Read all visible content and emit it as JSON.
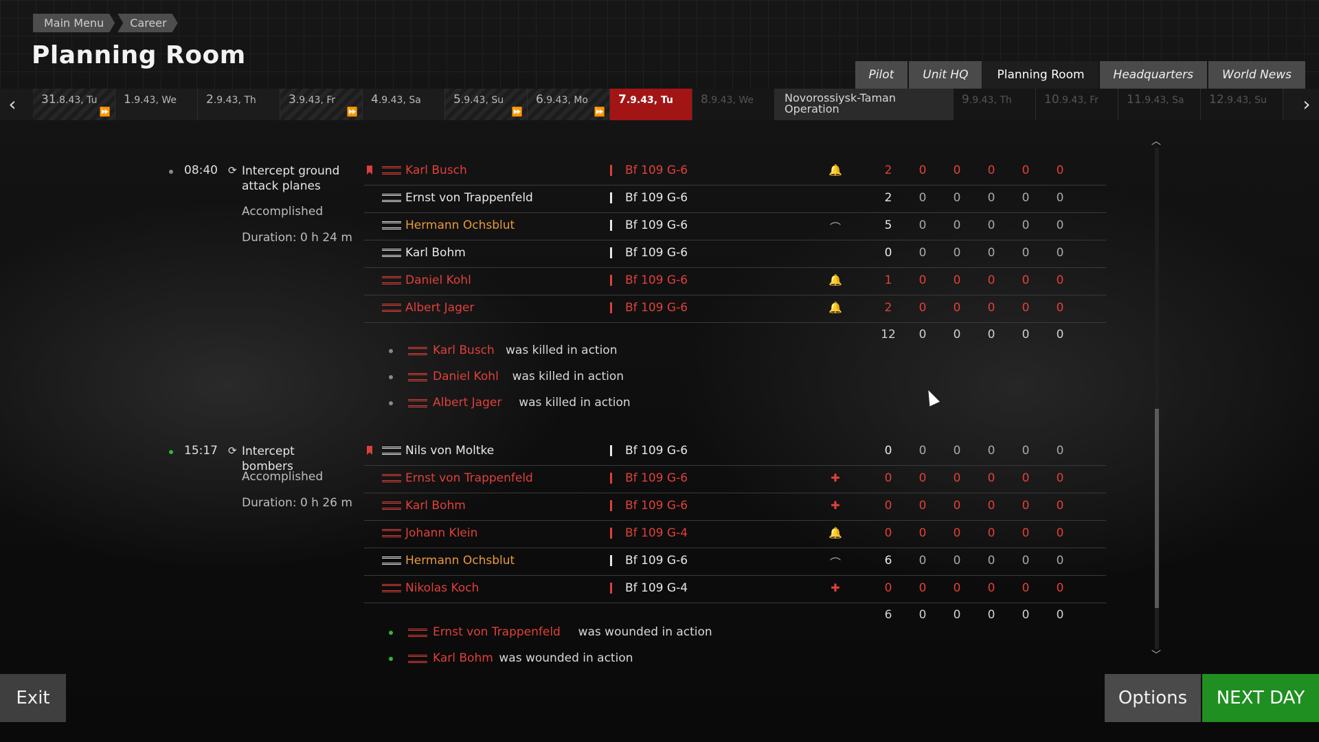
{
  "breadcrumb": [
    "Main Menu",
    "Career"
  ],
  "title": "Planning Room",
  "tabs": [
    {
      "label": "Pilot",
      "active": false
    },
    {
      "label": "Unit HQ",
      "active": false
    },
    {
      "label": "Planning Room",
      "active": true
    },
    {
      "label": "Headquarters",
      "active": false
    },
    {
      "label": "World News",
      "active": false
    }
  ],
  "timeline": {
    "days": [
      {
        "num": "31",
        "rest": ".8.43, Tu",
        "style": "striped"
      },
      {
        "num": "1",
        "rest": ".9.43, We",
        "style": "plain"
      },
      {
        "num": "2",
        "rest": ".9.43, Th",
        "style": "plain"
      },
      {
        "num": "3",
        "rest": ".9.43, Fr",
        "style": "striped"
      },
      {
        "num": "4",
        "rest": ".9.43, Sa",
        "style": "plain"
      },
      {
        "num": "5",
        "rest": ".9.43, Su",
        "style": "striped"
      },
      {
        "num": "6",
        "rest": ".9.43, Mo",
        "style": "striped"
      },
      {
        "num": "7",
        "rest": ".9.43, Tu",
        "style": "today"
      },
      {
        "num": "8",
        "rest": ".9.43, We",
        "style": "future"
      }
    ],
    "operation": "Novorossiysk-Taman Operation",
    "future_days": [
      {
        "num": "9",
        "rest": ".9.43, Th"
      },
      {
        "num": "10",
        "rest": ".9.43, Fr"
      },
      {
        "num": "11",
        "rest": ".9.43, Sa"
      },
      {
        "num": "12",
        "rest": ".9.43, Su"
      }
    ]
  },
  "missions": [
    {
      "time": "08:40",
      "task": "Intercept ground attack planes",
      "status": "Accomplished",
      "duration": "Duration: 0 h 24 m",
      "pilots": [
        {
          "name": "Karl Busch",
          "plane": "Bf 109 G-6",
          "color": "red",
          "status_icon": "killed-icon",
          "stats": [
            2,
            0,
            0,
            0,
            0,
            0
          ],
          "leader": true
        },
        {
          "name": "Ernst von Trappenfeld",
          "plane": "Bf 109 G-6",
          "color": "white",
          "status_icon": "",
          "stats": [
            2,
            0,
            0,
            0,
            0,
            0
          ]
        },
        {
          "name": "Hermann Ochsblut",
          "plane": "Bf 109 G-6",
          "color": "white",
          "name_color": "orange",
          "status_icon": "ace-icon",
          "stats": [
            5,
            0,
            0,
            0,
            0,
            0
          ]
        },
        {
          "name": "Karl Bohm",
          "plane": "Bf 109 G-6",
          "color": "white",
          "status_icon": "",
          "stats": [
            0,
            0,
            0,
            0,
            0,
            0
          ]
        },
        {
          "name": "Daniel Kohl",
          "plane": "Bf 109 G-6",
          "color": "red",
          "status_icon": "killed-icon",
          "stats": [
            1,
            0,
            0,
            0,
            0,
            0
          ]
        },
        {
          "name": "Albert Jager",
          "plane": "Bf 109 G-6",
          "color": "red",
          "status_icon": "killed-icon",
          "stats": [
            2,
            0,
            0,
            0,
            0,
            0
          ]
        }
      ],
      "totals": [
        12,
        0,
        0,
        0,
        0,
        0
      ],
      "events": [
        {
          "name": "Karl Busch",
          "text": "was killed in action"
        },
        {
          "name": "Daniel Kohl",
          "text": "was killed in action"
        },
        {
          "name": "Albert Jager",
          "text": "was killed in action"
        }
      ]
    },
    {
      "time": "15:17",
      "task": "Intercept bombers",
      "status": "Accomplished",
      "duration": "Duration: 0 h 26 m",
      "pilots": [
        {
          "name": "Nils von Moltke",
          "plane": "Bf 109 G-6",
          "color": "white",
          "status_icon": "",
          "stats": [
            0,
            0,
            0,
            0,
            0,
            0
          ],
          "leader": true
        },
        {
          "name": "Ernst von Trappenfeld",
          "plane": "Bf 109 G-6",
          "color": "red",
          "status_icon": "wounded-icon",
          "stats": [
            0,
            0,
            0,
            0,
            0,
            0
          ]
        },
        {
          "name": "Karl Bohm",
          "plane": "Bf 109 G-6",
          "color": "red",
          "status_icon": "wounded-icon",
          "stats": [
            0,
            0,
            0,
            0,
            0,
            0
          ]
        },
        {
          "name": "Johann Klein",
          "plane": "Bf 109 G-4",
          "color": "red",
          "status_icon": "killed-icon",
          "stats": [
            0,
            0,
            0,
            0,
            0,
            0
          ]
        },
        {
          "name": "Hermann Ochsblut",
          "plane": "Bf 109 G-6",
          "color": "white",
          "name_color": "orange",
          "status_icon": "ace-icon",
          "stats": [
            6,
            0,
            0,
            0,
            0,
            0
          ]
        },
        {
          "name": "Nikolas Koch",
          "plane": "Bf 109 G-4",
          "color": "red",
          "name_plane_white": true,
          "status_icon": "wounded-icon",
          "stats": [
            0,
            0,
            0,
            0,
            0,
            0
          ]
        }
      ],
      "totals": [
        6,
        0,
        0,
        0,
        0,
        0
      ],
      "events": [
        {
          "name": "Ernst von Trappenfeld",
          "text": "was wounded in action"
        },
        {
          "name": "Karl Bohm",
          "text": "was wounded in action"
        }
      ]
    }
  ],
  "buttons": {
    "exit": "Exit",
    "options": "Options",
    "next_day": "NEXT DAY"
  },
  "colors": {
    "accent_red": "#e0403a",
    "today": "#a31515",
    "next_day": "#1f8f21",
    "orange_name": "#e89a3c"
  }
}
